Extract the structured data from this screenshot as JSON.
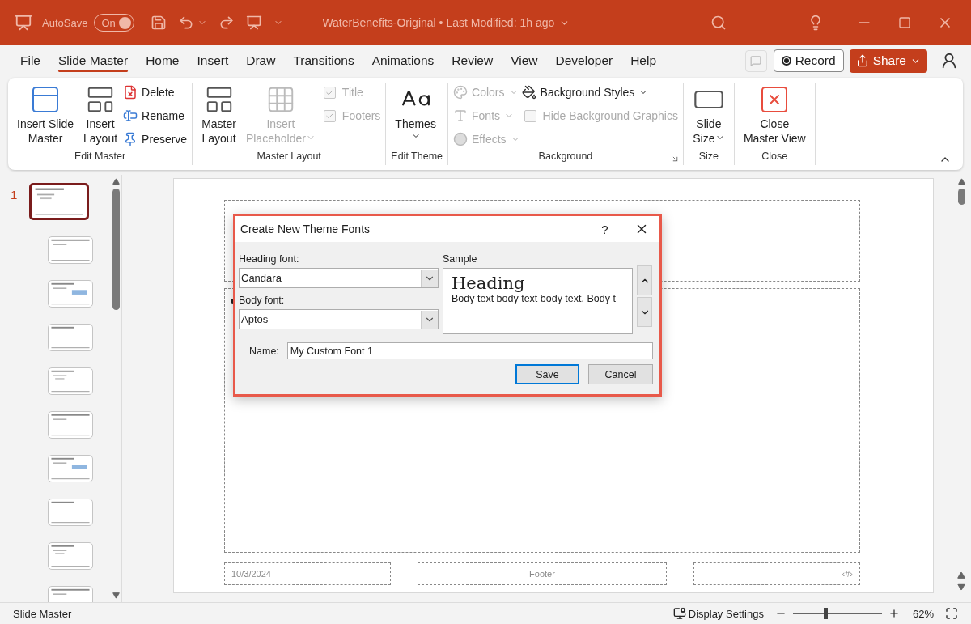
{
  "title_bar": {
    "autosave_label": "AutoSave",
    "autosave": {
      "label": "On",
      "on": true
    },
    "document_title": "WaterBenefits-Original",
    "separator": "•",
    "modified": "Last Modified: 1h ago"
  },
  "menu_tabs": [
    {
      "label": "File",
      "selected": false
    },
    {
      "label": "Slide Master",
      "selected": true
    },
    {
      "label": "Home",
      "selected": false
    },
    {
      "label": "Insert",
      "selected": false
    },
    {
      "label": "Draw",
      "selected": false
    },
    {
      "label": "Transitions",
      "selected": false
    },
    {
      "label": "Animations",
      "selected": false
    },
    {
      "label": "Review",
      "selected": false
    },
    {
      "label": "View",
      "selected": false
    },
    {
      "label": "Developer",
      "selected": false
    },
    {
      "label": "Help",
      "selected": false
    }
  ],
  "header_buttons": {
    "record": "Record",
    "share": "Share"
  },
  "ribbon": {
    "groups": [
      {
        "label": "Edit Master",
        "launcher": false,
        "columns": [
          [
            {
              "kind": "large",
              "lines": [
                "Insert Slide",
                "Master"
              ],
              "disabled": false,
              "dropdown": false
            }
          ],
          [
            {
              "kind": "large",
              "lines": [
                "Insert",
                "Layout"
              ],
              "disabled": false,
              "dropdown": false
            }
          ],
          [
            {
              "kind": "small",
              "label": "Delete",
              "disabled": false,
              "dropdown": false
            },
            {
              "kind": "small",
              "label": "Rename",
              "disabled": false,
              "dropdown": false
            },
            {
              "kind": "small",
              "label": "Preserve",
              "disabled": false,
              "dropdown": false
            }
          ]
        ]
      },
      {
        "label": "Master Layout",
        "launcher": false,
        "columns": [
          [
            {
              "kind": "large",
              "lines": [
                "Master",
                "Layout"
              ],
              "disabled": false,
              "dropdown": false
            }
          ],
          [
            {
              "kind": "large",
              "lines": [
                "Insert",
                "Placeholder"
              ],
              "disabled": true,
              "dropdown": true
            }
          ],
          [
            {
              "kind": "check",
              "label": "Title",
              "checked": true,
              "disabled": true
            },
            {
              "kind": "check",
              "label": "Footers",
              "checked": true,
              "disabled": true
            }
          ]
        ]
      },
      {
        "label": "Edit Theme",
        "launcher": false,
        "columns": [
          [
            {
              "kind": "large",
              "lines": [
                "Themes"
              ],
              "disabled": false,
              "dropdown": true
            }
          ]
        ]
      },
      {
        "label": "Background",
        "launcher": true,
        "columns": [
          [
            {
              "kind": "small",
              "label": "Colors",
              "disabled": true,
              "dropdown": true
            },
            {
              "kind": "small",
              "label": "Fonts",
              "disabled": true,
              "dropdown": true
            },
            {
              "kind": "small",
              "label": "Effects",
              "disabled": true,
              "dropdown": true
            }
          ],
          [
            {
              "kind": "small",
              "label": "Background Styles",
              "disabled": false,
              "dropdown": true
            },
            {
              "kind": "check",
              "label": "Hide Background Graphics",
              "checked": false,
              "disabled": true
            }
          ]
        ]
      },
      {
        "label": "Size",
        "launcher": false,
        "columns": [
          [
            {
              "kind": "large",
              "lines": [
                "Slide",
                "Size"
              ],
              "disabled": false,
              "dropdown": true
            }
          ]
        ]
      },
      {
        "label": "Close",
        "launcher": false,
        "columns": [
          [
            {
              "kind": "large",
              "lines": [
                "Close",
                "Master View"
              ],
              "disabled": false,
              "dropdown": false
            }
          ]
        ]
      }
    ]
  },
  "thumbnail_panel": {
    "number": "1",
    "thumbnails": [
      {
        "selected": true
      },
      {
        "selected": false
      },
      {
        "selected": false
      },
      {
        "selected": false
      },
      {
        "selected": false
      },
      {
        "selected": false
      },
      {
        "selected": false
      },
      {
        "selected": false
      },
      {
        "selected": false
      },
      {
        "selected": false
      }
    ]
  },
  "slide": {
    "date": "10/3/2024",
    "footer": "Footer",
    "slide_number": "‹#›"
  },
  "dialog": {
    "title": "Create New Theme Fonts",
    "help": "?",
    "heading_label": "Heading font:",
    "heading_value": "Candara",
    "body_label": "Body font:",
    "body_value": "Aptos",
    "sample_label": "Sample",
    "sample_heading": "Heading",
    "sample_body": "Body text body text body text. Body t",
    "name_label": "Name:",
    "name_value": "My Custom Font 1",
    "buttons": [
      {
        "label": "Save",
        "default": true
      },
      {
        "label": "Cancel",
        "default": false
      }
    ]
  },
  "status_bar": {
    "mode": "Slide Master",
    "display_settings": "Display Settings",
    "zoom": {
      "level": 0.36
    },
    "zoom_percent": "62%"
  }
}
